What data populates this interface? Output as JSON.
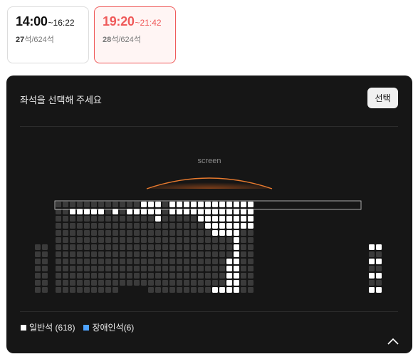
{
  "showtimes": [
    {
      "start": "14:00",
      "end": "~16:22",
      "seats_available": "27",
      "seats_suffix": "석/624석",
      "selected": false
    },
    {
      "start": "19:20",
      "end": "~21:42",
      "seats_available": "28",
      "seats_suffix": "석/624석",
      "selected": true
    }
  ],
  "panel": {
    "title": "좌석을 선택해 주세요",
    "select_button": "선택",
    "screen_label": "screen"
  },
  "legend": {
    "general": {
      "label": "일반석 (618)",
      "color": "#ffffff"
    },
    "disabled": {
      "label": "장애인석(6)",
      "color": "#4ea3ff"
    }
  },
  "icons": {
    "collapse": "chevron-up-icon"
  },
  "colors": {
    "accent": "#ef5a5a",
    "seat_taken": "#3b3b3b",
    "seat_open": "#ffffff",
    "panel_bg": "#161616"
  }
}
